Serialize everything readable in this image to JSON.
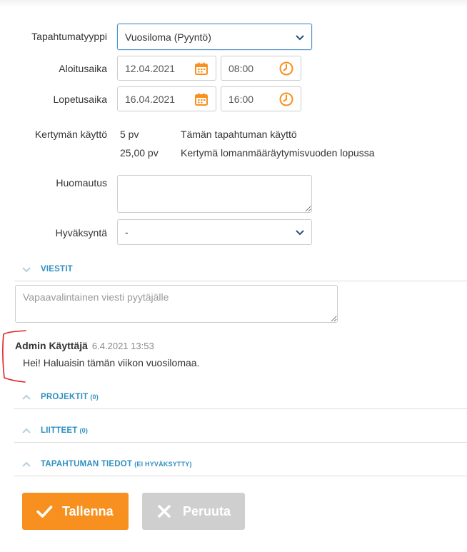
{
  "form": {
    "event_type": {
      "label": "Tapahtumatyyppi",
      "value": "Vuosiloma (Pyyntö)"
    },
    "start": {
      "label": "Aloitusaika",
      "date": "12.04.2021",
      "time": "08:00"
    },
    "end": {
      "label": "Lopetusaika",
      "date": "16.04.2021",
      "time": "16:00"
    },
    "accrual": {
      "label": "Kertymän käyttö",
      "rows": [
        {
          "amount": "5 pv",
          "description": "Tämän tapahtuman käyttö"
        },
        {
          "amount": "25,00 pv",
          "description": "Kertymä lomanmääräytymisvuoden lopussa"
        }
      ]
    },
    "note": {
      "label": "Huomautus",
      "value": ""
    },
    "approval": {
      "label": "Hyväksyntä",
      "value": "-"
    }
  },
  "messages": {
    "section_title": "VIESTIT",
    "input_placeholder": "Vapaavalintainen viesti pyytäjälle",
    "items": [
      {
        "author": "Admin Käyttäjä",
        "timestamp": "6.4.2021 13:53",
        "text": "Hei! Haluaisin tämän viikon vuosilomaa."
      }
    ]
  },
  "sections": [
    {
      "title": "PROJEKTIT",
      "count": "(0)"
    },
    {
      "title": "LIITTEET",
      "count": "(0)"
    },
    {
      "title": "TAPAHTUMAN TIEDOT",
      "count": "(EI HYVÄKSYTTY)"
    }
  ],
  "actions": {
    "save_label": "Tallenna",
    "cancel_label": "Peruuta"
  },
  "colors": {
    "accent_orange": "#f7901e",
    "section_blue": "#2f8fc2",
    "select_border_blue": "#4a90c8",
    "disabled_gray": "#cfcfcf",
    "annotation_red": "#e02020"
  },
  "icons": {
    "date": "calendar-icon",
    "time": "clock-icon",
    "dropdown": "chevron-down-icon",
    "section_collapsed": "chevron-down-icon",
    "section_expanded": "chevron-up-icon",
    "save": "checkmark-icon",
    "cancel": "cross-icon"
  }
}
